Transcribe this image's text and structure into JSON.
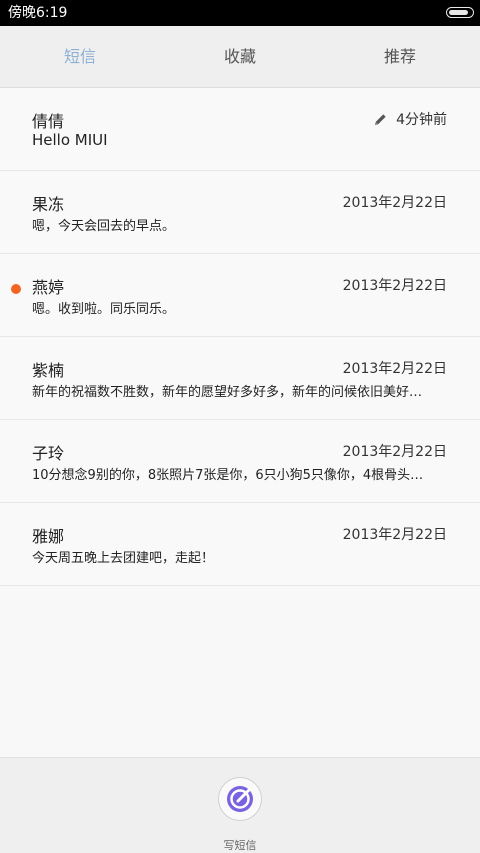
{
  "status_bar": {
    "time": "傍晚6:19",
    "battery_level": 0.9
  },
  "tabs": [
    {
      "label": "短信",
      "active": true
    },
    {
      "label": "收藏",
      "active": false
    },
    {
      "label": "推荐",
      "active": false
    }
  ],
  "conversations": [
    {
      "name": "倩倩",
      "date": "4分钟前",
      "snippet": "Hello MIUI",
      "draft": true,
      "unread": false
    },
    {
      "name": "果冻",
      "date": "2013年2月22日",
      "snippet": "嗯，今天会回去的早点。",
      "draft": false,
      "unread": false
    },
    {
      "name": "燕婷",
      "date": "2013年2月22日",
      "snippet": "嗯。收到啦。同乐同乐。",
      "draft": false,
      "unread": true
    },
    {
      "name": "紫楠",
      "date": "2013年2月22日",
      "snippet": "新年的祝福数不胜数，新年的愿望好多好多，新年的问候依旧美好…",
      "draft": false,
      "unread": false
    },
    {
      "name": "子玲",
      "date": "2013年2月22日",
      "snippet": "10分想念9别的你，8张照片7张是你，6只小狗5只像你，4根骨头…",
      "draft": false,
      "unread": false
    },
    {
      "name": "雅娜",
      "date": "2013年2月22日",
      "snippet": "今天周五晚上去团建吧，走起！",
      "draft": false,
      "unread": false
    }
  ],
  "bottom_bar": {
    "compose_label": "写短信"
  },
  "colors": {
    "accent_tab": "#8db0d6",
    "unread_dot": "#f26522",
    "compose_icon": "#7a62e0"
  }
}
